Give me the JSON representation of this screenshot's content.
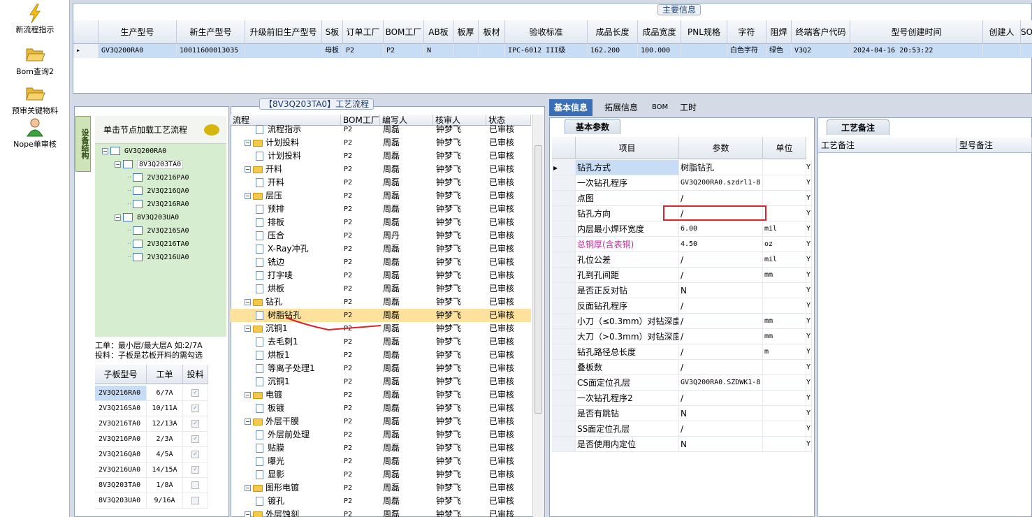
{
  "launcher": {
    "items": [
      {
        "label": "新流程指示",
        "icon": "lightning-icon"
      },
      {
        "label": "Bom查询2",
        "icon": "folder-open-icon"
      },
      {
        "label": "预审关键物料",
        "icon": "folder-open-icon"
      },
      {
        "label": "Nope单审核",
        "icon": "user-icon"
      }
    ]
  },
  "main_info": {
    "title": "主要信息",
    "columns": [
      "生产型号",
      "新生产型号",
      "升级前旧生产型号",
      "S板",
      "订单工厂",
      "BOM工厂",
      "AB板",
      "板厚",
      "板材",
      "验收标准",
      "成品长度",
      "成品宽度",
      "PNL规格",
      "字符",
      "阻焊",
      "终端客户代码",
      "型号创建时间",
      "创建人",
      "SO"
    ],
    "row": [
      "GV3Q200RA0",
      "10011600013035",
      "",
      "母板",
      "P2",
      "P2",
      "N",
      "",
      "",
      "IPC-6012 III级",
      "162.200",
      "100.000",
      "",
      "白色字符",
      "绿色",
      "V3Q2",
      "2024-04-16 20:53:22",
      "",
      ""
    ]
  },
  "tree": {
    "vertical_tab": "设备结构",
    "header": "单击节点加载工艺流程",
    "nodes": [
      {
        "label": "GV3Q200RA0",
        "level": 0,
        "toggle": "−"
      },
      {
        "label": "8V3Q203TA0",
        "level": 1,
        "toggle": "−"
      },
      {
        "label": "2V3Q216PA0",
        "level": 2
      },
      {
        "label": "2V3Q216QA0",
        "level": 2
      },
      {
        "label": "2V3Q216RA0",
        "level": 2
      },
      {
        "label": "8V3Q203UA0",
        "level": 1,
        "toggle": "−"
      },
      {
        "label": "2V3Q216SA0",
        "level": 2
      },
      {
        "label": "2V3Q216TA0",
        "level": 2
      },
      {
        "label": "2V3Q216UA0",
        "level": 2
      }
    ],
    "note_line1": "工单：最小层/最大层A 如:2/7A",
    "note_line2": "投料：子板是芯板开料的需勾选",
    "sub_columns": [
      "子板型号",
      "工单",
      "投料"
    ],
    "sub_rows": [
      {
        "model": "2V3Q216RA0",
        "order": "6/7A",
        "checked": true
      },
      {
        "model": "2V3Q216SA0",
        "order": "10/11A",
        "checked": true
      },
      {
        "model": "2V3Q216TA0",
        "order": "12/13A",
        "checked": true
      },
      {
        "model": "2V3Q216PA0",
        "order": "2/3A",
        "checked": true
      },
      {
        "model": "2V3Q216QA0",
        "order": "4/5A",
        "checked": true
      },
      {
        "model": "2V3Q216UA0",
        "order": "14/15A",
        "checked": true
      },
      {
        "model": "8V3Q203TA0",
        "order": "1/8A",
        "checked": false
      },
      {
        "model": "8V3Q203UA0",
        "order": "9/16A",
        "checked": false
      }
    ]
  },
  "process": {
    "title": "【8V3Q203TA0】工艺流程",
    "columns": [
      "流程",
      "BOM工厂",
      "编写人",
      "核审人",
      "状态"
    ],
    "rows": [
      {
        "name": "流程指示",
        "type": "doc",
        "level": 1,
        "bom": "P2",
        "writer": "周磊",
        "reviewer": "钟梦飞",
        "status": "已审核"
      },
      {
        "name": "计划投料",
        "type": "folder",
        "level": 0,
        "bom": "P2",
        "writer": "周磊",
        "reviewer": "钟梦飞",
        "status": "已审核"
      },
      {
        "name": "计划投料",
        "type": "doc",
        "level": 1,
        "bom": "P2",
        "writer": "周磊",
        "reviewer": "钟梦飞",
        "status": "已审核"
      },
      {
        "name": "开料",
        "type": "folder",
        "level": 0,
        "bom": "P2",
        "writer": "周磊",
        "reviewer": "钟梦飞",
        "status": "已审核"
      },
      {
        "name": "开料",
        "type": "doc",
        "level": 1,
        "bom": "P2",
        "writer": "周磊",
        "reviewer": "钟梦飞",
        "status": "已审核"
      },
      {
        "name": "层压",
        "type": "folder",
        "level": 0,
        "bom": "P2",
        "writer": "周磊",
        "reviewer": "钟梦飞",
        "status": "已审核"
      },
      {
        "name": "预排",
        "type": "doc",
        "level": 1,
        "bom": "P2",
        "writer": "周磊",
        "reviewer": "钟梦飞",
        "status": "已审核"
      },
      {
        "name": "排板",
        "type": "doc",
        "level": 1,
        "bom": "P2",
        "writer": "周磊",
        "reviewer": "钟梦飞",
        "status": "已审核"
      },
      {
        "name": "压合",
        "type": "doc",
        "level": 1,
        "bom": "P2",
        "writer": "周丹",
        "reviewer": "钟梦飞",
        "status": "已审核"
      },
      {
        "name": "X-Ray冲孔",
        "type": "doc",
        "level": 1,
        "bom": "P2",
        "writer": "周磊",
        "reviewer": "钟梦飞",
        "status": "已审核"
      },
      {
        "name": "铣边",
        "type": "doc",
        "level": 1,
        "bom": "P2",
        "writer": "周磊",
        "reviewer": "钟梦飞",
        "status": "已审核"
      },
      {
        "name": "打字唛",
        "type": "doc",
        "level": 1,
        "bom": "P2",
        "writer": "周磊",
        "reviewer": "钟梦飞",
        "status": "已审核"
      },
      {
        "name": "烘板",
        "type": "doc",
        "level": 1,
        "bom": "P2",
        "writer": "周磊",
        "reviewer": "钟梦飞",
        "status": "已审核"
      },
      {
        "name": "钻孔",
        "type": "folder",
        "level": 0,
        "bom": "P2",
        "writer": "周磊",
        "reviewer": "钟梦飞",
        "status": "已审核"
      },
      {
        "name": "树脂钻孔",
        "type": "doc",
        "level": 1,
        "bom": "P2",
        "writer": "周磊",
        "reviewer": "钟梦飞",
        "status": "已审核",
        "selected": true
      },
      {
        "name": "沉铜1",
        "type": "folder",
        "level": 0,
        "bom": "P2",
        "writer": "周磊",
        "reviewer": "钟梦飞",
        "status": "已审核"
      },
      {
        "name": "去毛刺1",
        "type": "doc",
        "level": 1,
        "bom": "P2",
        "writer": "周磊",
        "reviewer": "钟梦飞",
        "status": "已审核"
      },
      {
        "name": "烘板1",
        "type": "doc",
        "level": 1,
        "bom": "P2",
        "writer": "周磊",
        "reviewer": "钟梦飞",
        "status": "已审核"
      },
      {
        "name": "等离子处理1",
        "type": "doc",
        "level": 1,
        "bom": "P2",
        "writer": "周磊",
        "reviewer": "钟梦飞",
        "status": "已审核"
      },
      {
        "name": "沉铜1",
        "type": "doc",
        "level": 1,
        "bom": "P2",
        "writer": "周磊",
        "reviewer": "钟梦飞",
        "status": "已审核"
      },
      {
        "name": "电镀",
        "type": "folder",
        "level": 0,
        "bom": "P2",
        "writer": "周磊",
        "reviewer": "钟梦飞",
        "status": "已审核"
      },
      {
        "name": "板镀",
        "type": "doc",
        "level": 1,
        "bom": "P2",
        "writer": "周磊",
        "reviewer": "钟梦飞",
        "status": "已审核"
      },
      {
        "name": "外层干膜",
        "type": "folder",
        "level": 0,
        "bom": "P2",
        "writer": "周磊",
        "reviewer": "钟梦飞",
        "status": "已审核"
      },
      {
        "name": "外层前处理",
        "type": "doc",
        "level": 1,
        "bom": "P2",
        "writer": "周磊",
        "reviewer": "钟梦飞",
        "status": "已审核"
      },
      {
        "name": "贴膜",
        "type": "doc",
        "level": 1,
        "bom": "P2",
        "writer": "周磊",
        "reviewer": "钟梦飞",
        "status": "已审核"
      },
      {
        "name": "曝光",
        "type": "doc",
        "level": 1,
        "bom": "P2",
        "writer": "周磊",
        "reviewer": "钟梦飞",
        "status": "已审核"
      },
      {
        "name": "显影",
        "type": "doc",
        "level": 1,
        "bom": "P2",
        "writer": "周磊",
        "reviewer": "钟梦飞",
        "status": "已审核"
      },
      {
        "name": "图形电镀",
        "type": "folder",
        "level": 0,
        "bom": "P2",
        "writer": "周磊",
        "reviewer": "钟梦飞",
        "status": "已审核"
      },
      {
        "name": "镀孔",
        "type": "doc",
        "level": 1,
        "bom": "P2",
        "writer": "周磊",
        "reviewer": "钟梦飞",
        "status": "已审核"
      },
      {
        "name": "外层蚀刻",
        "type": "folder",
        "level": 0,
        "bom": "P2",
        "writer": "周磊",
        "reviewer": "钟梦飞",
        "status": "已审核"
      }
    ]
  },
  "info_tabs": [
    "基本信息",
    "拓展信息",
    "BOM",
    "工时"
  ],
  "basic": {
    "subtab": "基本参数",
    "columns": [
      "项目",
      "参数",
      "单位"
    ],
    "rows": [
      {
        "item": "钻孔方式",
        "value": "树脂钻孔",
        "unit": "",
        "flag": "Y",
        "current": true
      },
      {
        "item": "一次钻孔程序",
        "value": "GV3Q200RA0.szdrl1-8",
        "unit": "",
        "flag": "Y"
      },
      {
        "item": "点图",
        "value": "/",
        "unit": "",
        "flag": "Y"
      },
      {
        "item": "钻孔方向",
        "value": "/",
        "unit": "",
        "flag": "Y"
      },
      {
        "item": "内层最小焊环宽度",
        "value": "6.00",
        "unit": "mil",
        "flag": "Y"
      },
      {
        "item": "总铜厚(含表铜)",
        "value": "4.50",
        "unit": "oz",
        "flag": "Y",
        "pink": true
      },
      {
        "item": "孔位公差",
        "value": "/",
        "unit": "mil",
        "flag": "Y"
      },
      {
        "item": "孔到孔间距",
        "value": "/",
        "unit": "mm",
        "flag": "Y"
      },
      {
        "item": "是否正反对钻",
        "value": "N",
        "unit": "",
        "flag": "Y"
      },
      {
        "item": "反面钻孔程序",
        "value": "/",
        "unit": "",
        "flag": "Y"
      },
      {
        "item": "小刀（≤0.3mm）对钻深度",
        "value": "/",
        "unit": "mm",
        "flag": "Y"
      },
      {
        "item": "大刀（>0.3mm）对钻深度",
        "value": "/",
        "unit": "mm",
        "flag": "Y"
      },
      {
        "item": "钻孔路径总长度",
        "value": "/",
        "unit": "m",
        "flag": "Y"
      },
      {
        "item": "叠板数",
        "value": "/",
        "unit": "",
        "flag": "Y"
      },
      {
        "item": "CS面定位孔层",
        "value": "GV3Q200RA0.SZDWK1-8",
        "unit": "",
        "flag": "Y"
      },
      {
        "item": "一次钻孔程序2",
        "value": "/",
        "unit": "",
        "flag": "Y"
      },
      {
        "item": "是否有跳钻",
        "value": "N",
        "unit": "",
        "flag": "Y"
      },
      {
        "item": "SS面定位孔层",
        "value": "/",
        "unit": "",
        "flag": "Y"
      },
      {
        "item": "是否使用内定位",
        "value": "N",
        "unit": "",
        "flag": "Y"
      }
    ]
  },
  "remarks": {
    "subtab": "工艺备注",
    "columns": [
      "工艺备注",
      "型号备注"
    ]
  },
  "colors": {
    "accent": "#3b6fb5",
    "selection": "#c7dcf5",
    "highlight": "#fde29e",
    "annotation": "#d8262c",
    "pink_text": "#c0279a"
  }
}
